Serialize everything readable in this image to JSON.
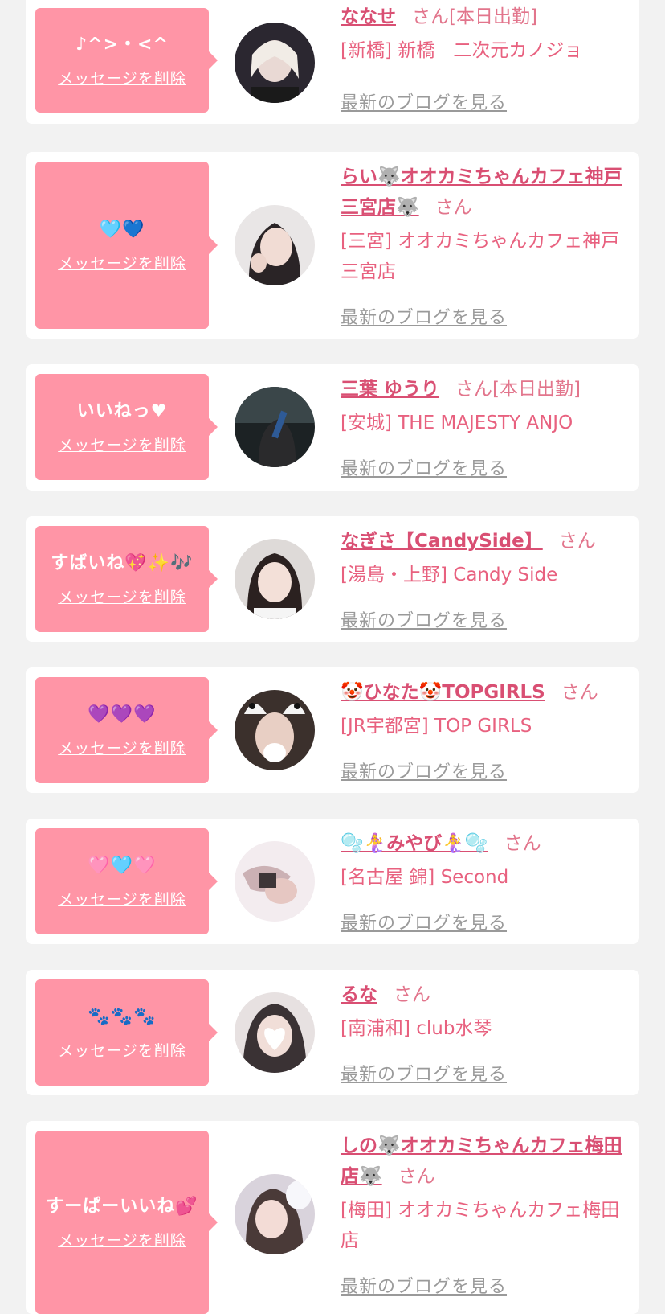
{
  "delete_label": "メッセージを削除",
  "blog_label": "最新のブログを見る",
  "honorific": "さん",
  "colors": {
    "background": "#f2f2f2",
    "bubble": "#ff95a6",
    "name": "#d94f73",
    "shop": "#e8617f",
    "blog": "#9a9a9a"
  },
  "items": [
    {
      "message": "♪^>・<^",
      "name": "ななせ",
      "status": "[本日出勤]",
      "shop": "[新橋] 新橋　二次元カノジョ",
      "avatar_icon": "girl-photo-1"
    },
    {
      "message": "🩵💙",
      "name": "らい🐺オオカミちゃんカフェ神戸三宮店🐺",
      "status": "",
      "shop": "[三宮] オオカミちゃんカフェ神戸三宮店",
      "avatar_icon": "girl-photo-2"
    },
    {
      "message": "いいねっ♥",
      "name": "三葉 ゆうり",
      "status": "[本日出勤]",
      "shop": "[安城] THE MAJESTY ANJO",
      "avatar_icon": "girl-photo-3"
    },
    {
      "message": "すばいね💖✨🎶",
      "name": "なぎさ【CandySide】",
      "status": "",
      "shop": "[湯島・上野] Candy Side",
      "avatar_icon": "girl-photo-4"
    },
    {
      "message": "💜💜💜",
      "name": "🤡ひなた🤡TOPGIRLS",
      "status": "",
      "shop": "[JR宇都宮] TOP GIRLS",
      "avatar_icon": "girl-photo-5"
    },
    {
      "message": "🩷🩵🩷",
      "name": "🫧🧜‍♀️みやび🧜‍♀️🫧",
      "status": "",
      "shop": "[名古屋 錦] Second",
      "avatar_icon": "girl-photo-6"
    },
    {
      "message": "🐾🐾🐾",
      "name": "るな",
      "status": "",
      "shop": "[南浦和] club水琴",
      "avatar_icon": "girl-photo-7"
    },
    {
      "message": "すーぱーいいね💕",
      "name": "しの🐺オオカミちゃんカフェ梅田店🐺",
      "status": "",
      "shop": "[梅田] オオカミちゃんカフェ梅田店",
      "avatar_icon": "girl-photo-8"
    }
  ]
}
